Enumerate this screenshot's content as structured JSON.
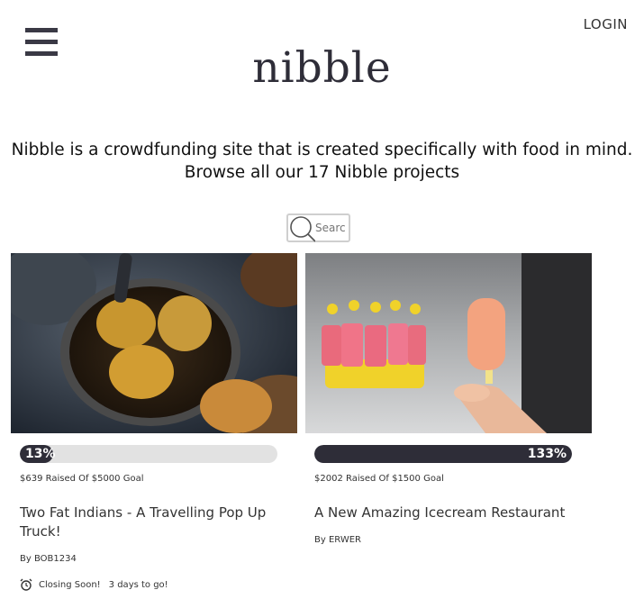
{
  "header": {
    "login_label": "LOGIN",
    "logo_text": "nibble"
  },
  "intro": {
    "tagline_line1": "Nibble is a crowdfunding site that is created specifically with food in mind.",
    "tagline_line2": "Browse all our 17 Nibble projects"
  },
  "search": {
    "placeholder": "Search"
  },
  "projects": [
    {
      "progress_label": "13%",
      "progress_fraction": 0.13,
      "raised_text": "$639 Raised Of $5000 Goal",
      "title": "Two Fat Indians - A Travelling Pop Up Truck!",
      "author": "By BOB1234",
      "status": "Closing Soon!",
      "days_left": "3 days to go!"
    },
    {
      "progress_label": "133%",
      "progress_fraction": 1.0,
      "raised_text": "$2002 Raised Of $1500 Goal",
      "title": "A New Amazing Icecream Restaurant",
      "author": "By ERWER"
    }
  ],
  "colors": {
    "brand_dark": "#2e2d38",
    "progress_track": "#e2e2e2"
  }
}
